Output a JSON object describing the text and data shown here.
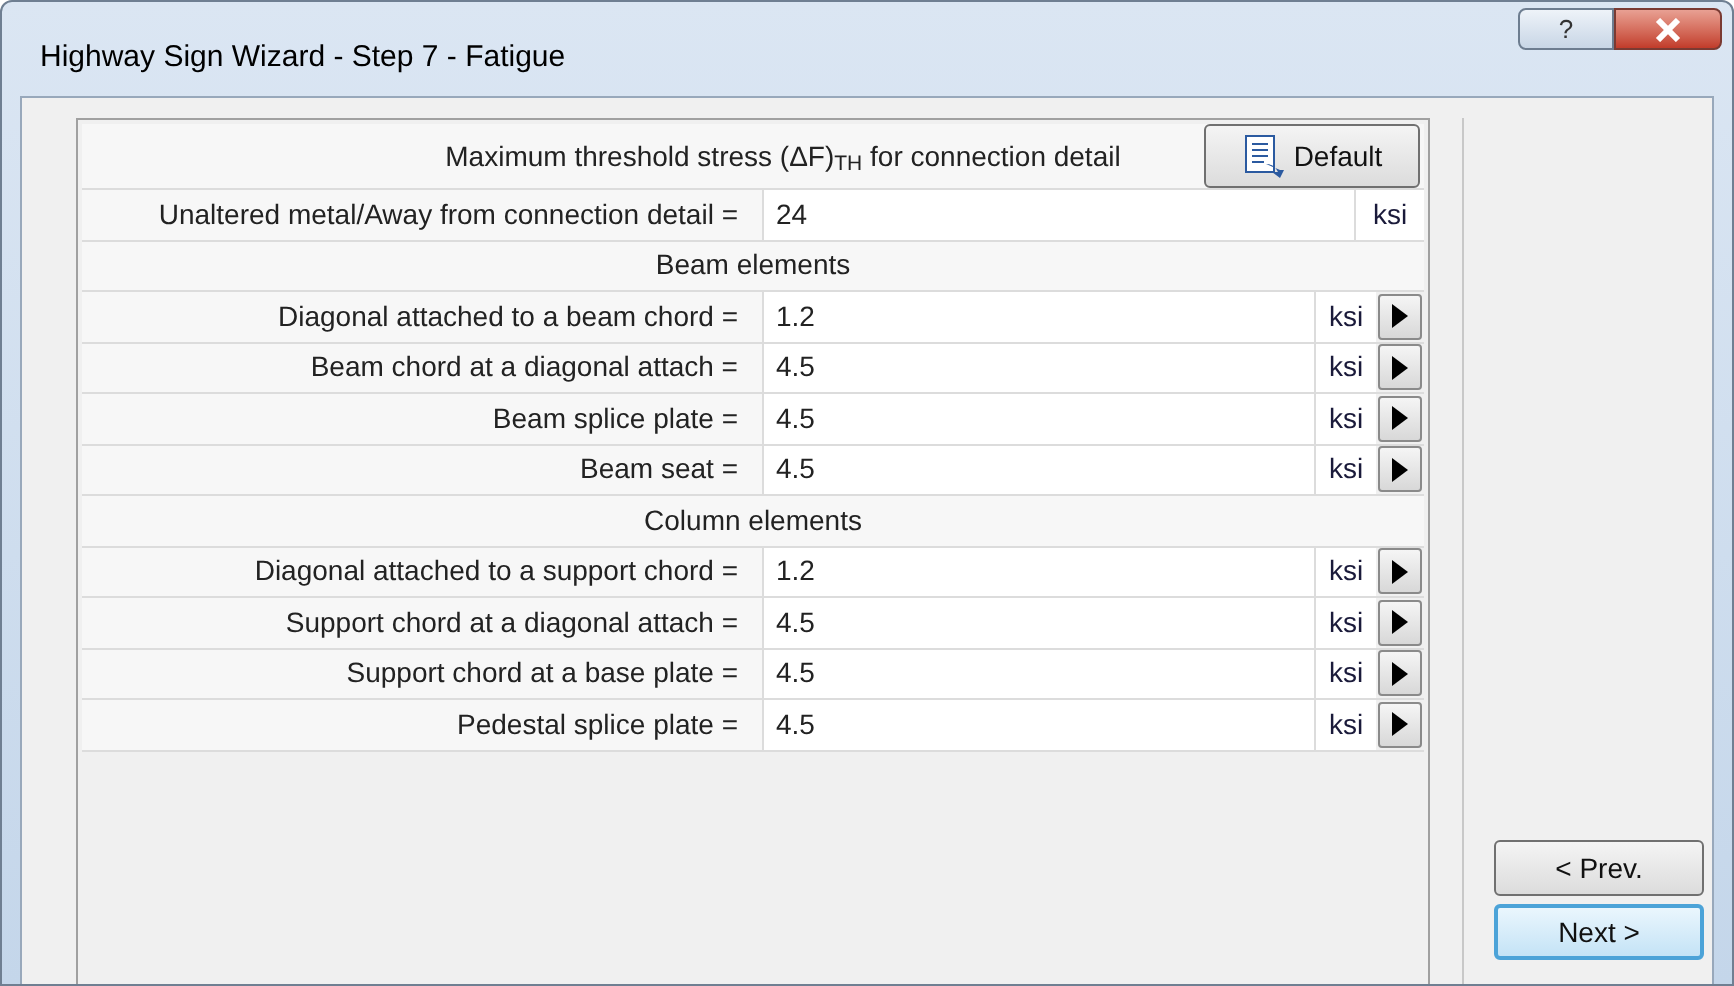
{
  "window": {
    "title": "Highway Sign Wizard - Step 7 - Fatigue",
    "caption_buttons": [
      {
        "kind": "help",
        "label": "?"
      },
      {
        "kind": "close"
      }
    ]
  },
  "table": {
    "heading": "Maximum threshold stress (ΔF)$_{TH}$ for connection detail",
    "default_button": "Default",
    "rows": [
      {
        "kind": "value",
        "label": "Unaltered metal/Away from connection detail =",
        "value": "24",
        "unit": "ksi",
        "has_arrow": false
      },
      {
        "kind": "section",
        "label": "Beam elements"
      },
      {
        "kind": "value",
        "label": "Diagonal attached to a beam chord =",
        "value": "1.2",
        "unit": "ksi",
        "has_arrow": true
      },
      {
        "kind": "value",
        "label": "Beam chord at a diagonal attach =",
        "value": "4.5",
        "unit": "ksi",
        "has_arrow": true
      },
      {
        "kind": "value",
        "label": "Beam splice plate =",
        "value": "4.5",
        "unit": "ksi",
        "has_arrow": true
      },
      {
        "kind": "value",
        "label": "Beam seat =",
        "value": "4.5",
        "unit": "ksi",
        "has_arrow": true
      },
      {
        "kind": "section",
        "label": "Column elements"
      },
      {
        "kind": "value",
        "label": "Diagonal attached to a support chord =",
        "value": "1.2",
        "unit": "ksi",
        "has_arrow": true
      },
      {
        "kind": "value",
        "label": "Support chord at a diagonal attach =",
        "value": "4.5",
        "unit": "ksi",
        "has_arrow": true
      },
      {
        "kind": "value",
        "label": "Support chord at a base plate =",
        "value": "4.5",
        "unit": "ksi",
        "has_arrow": true
      },
      {
        "kind": "value",
        "label": "Pedestal splice plate =",
        "value": "4.5",
        "unit": "ksi",
        "has_arrow": true
      }
    ]
  },
  "nav_buttons": [
    {
      "label": "< Prev.",
      "focused": false
    },
    {
      "label": "Next >",
      "focused": true
    }
  ]
}
